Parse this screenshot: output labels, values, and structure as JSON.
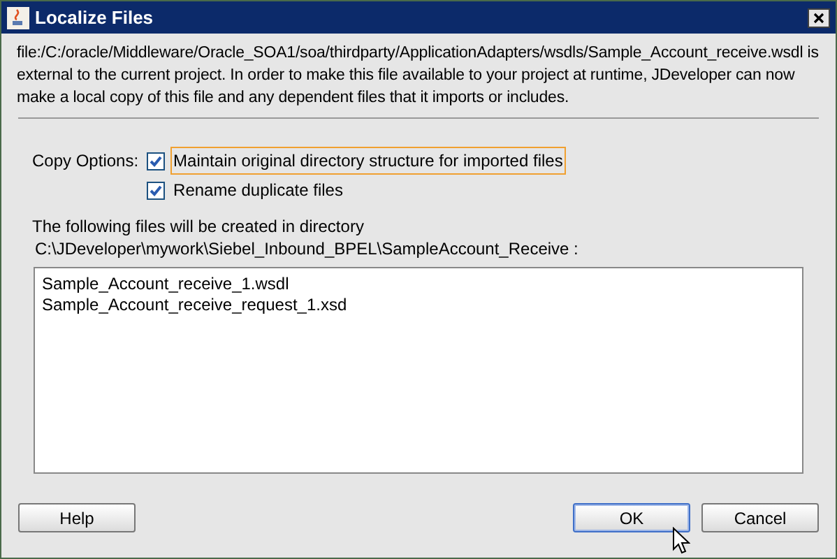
{
  "window": {
    "title": "Localize Files"
  },
  "message": "file:/C:/oracle/Middleware/Oracle_SOA1/soa/thirdparty/ApplicationAdapters/wsdls/Sample_Account_receive.wsdl is external to the current project. In order to make this file available to your project at runtime, JDeveloper can now make a local copy of this file and any dependent files that it imports or includes.",
  "copy_options": {
    "label": "Copy Options:",
    "options": [
      {
        "label": "Maintain original directory structure for imported files",
        "checked": true,
        "focused": true
      },
      {
        "label": "Rename duplicate files",
        "checked": true,
        "focused": false
      }
    ]
  },
  "files": {
    "heading": "The following files will be created in directory",
    "directory": "C:\\JDeveloper\\mywork\\Siebel_Inbound_BPEL\\SampleAccount_Receive :",
    "items": [
      "Sample_Account_receive_1.wsdl",
      "Sample_Account_receive_request_1.xsd"
    ]
  },
  "buttons": [
    {
      "label": "Help",
      "default": false
    },
    {
      "label": "OK",
      "default": true
    },
    {
      "label": "Cancel",
      "default": false
    }
  ]
}
